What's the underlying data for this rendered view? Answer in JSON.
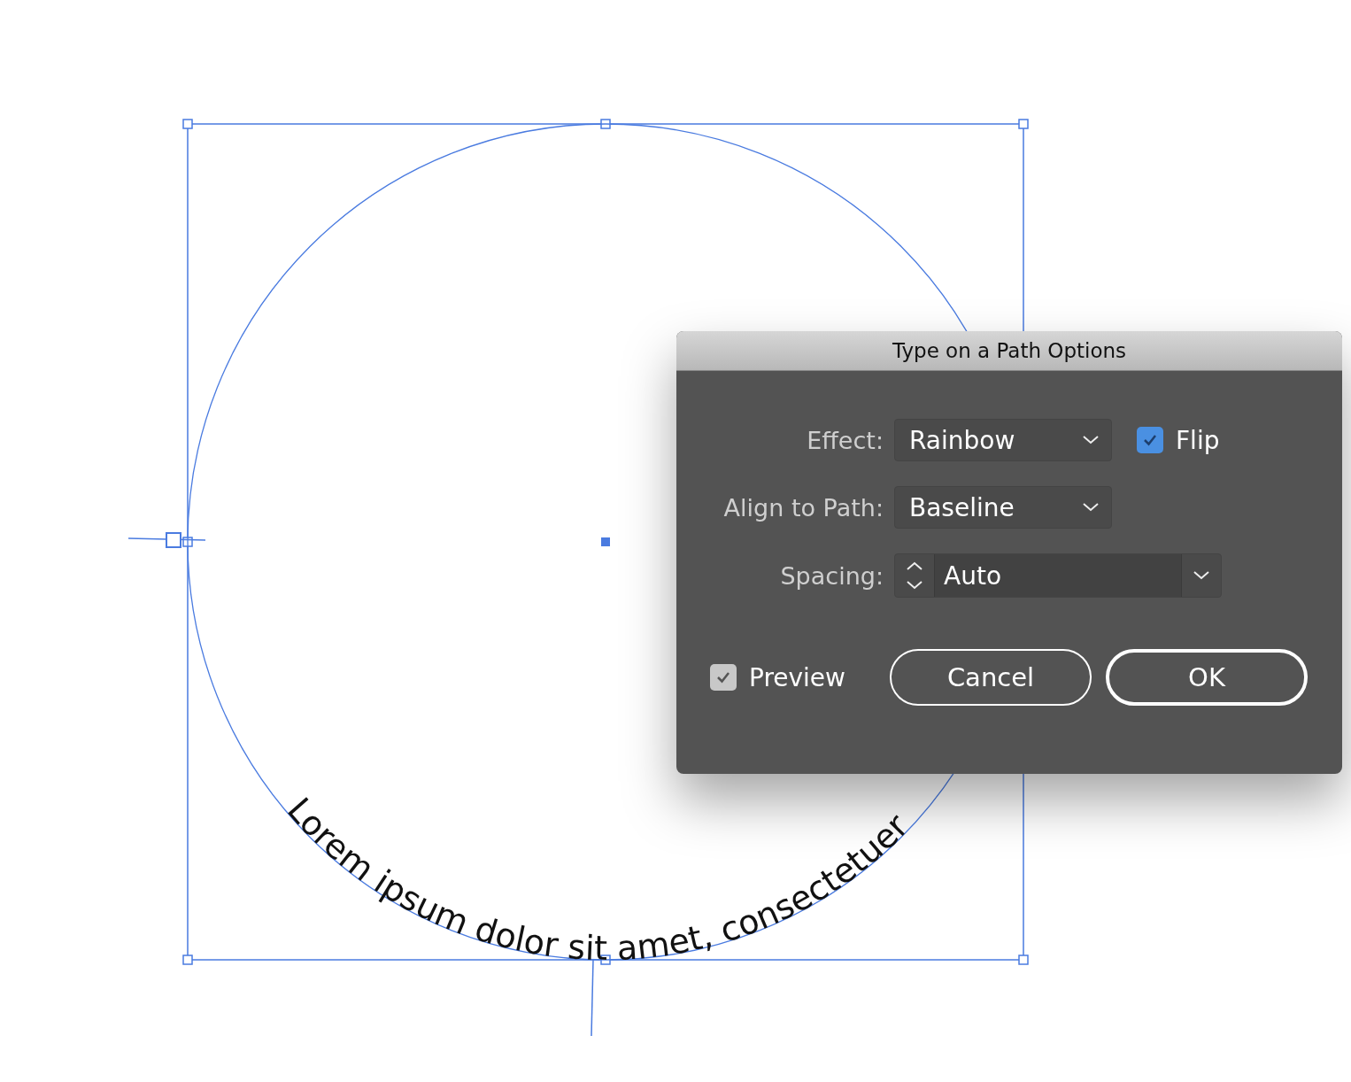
{
  "canvas": {
    "path_text": "Lorem ipsum dolor sit amet, consectetuer"
  },
  "dialog": {
    "title": "Type on a Path Options",
    "fields": [
      {
        "kind": "dropdown",
        "label": "Effect:",
        "value": "Rainbow"
      },
      {
        "kind": "dropdown",
        "label": "Align to Path:",
        "value": "Baseline"
      },
      {
        "kind": "stepper",
        "label": "Spacing:",
        "value": "Auto"
      }
    ],
    "flip": {
      "label": "Flip",
      "checked": true,
      "color": "#4a90e2"
    },
    "preview": {
      "label": "Preview",
      "checked": true,
      "color": "#c8c8c8"
    },
    "buttons": [
      {
        "label": "Cancel",
        "default": false
      },
      {
        "label": "OK",
        "default": true
      }
    ]
  }
}
